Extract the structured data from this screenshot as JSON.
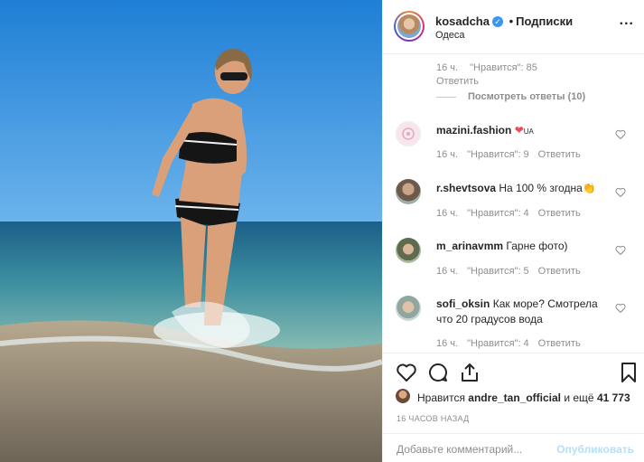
{
  "header": {
    "username": "kosadcha",
    "separator": "•",
    "follow_label": "Подписки",
    "location": "Одеса",
    "more": "..."
  },
  "thread_reply": {
    "time": "16 ч.",
    "likes": "\"Нравится\": 85",
    "reply_label": "Ответить",
    "view_replies": "Посмотреть ответы (10)"
  },
  "comments": [
    {
      "user": "mazini.fashion",
      "text": "❤",
      "suffix": "UA",
      "time": "16 ч.",
      "likes": "\"Нравится\": 9",
      "reply_label": "Ответить"
    },
    {
      "user": "r.shevtsova",
      "text": "На 100 % згодна👏",
      "time": "16 ч.",
      "likes": "\"Нравится\": 4",
      "reply_label": "Ответить"
    },
    {
      "user": "m_arinavmm",
      "text": "Гарне фото)",
      "time": "16 ч.",
      "likes": "\"Нравится\": 5",
      "reply_label": "Ответить"
    },
    {
      "user": "sofi_oksin",
      "text": "Как море? Смотрела что 20 градусов вода",
      "time": "16 ч.",
      "likes": "\"Нравится\": 4",
      "reply_label": "Ответить"
    }
  ],
  "likes_line": {
    "prefix": "Нравится",
    "user": "andre_tan_official",
    "middle": "и ещё",
    "count": "41 773"
  },
  "timestamp": "16 ЧАСОВ НАЗАД",
  "comment_box": {
    "placeholder": "Добавьте комментарий...",
    "publish_label": "Опубликовать"
  },
  "colors": {
    "accent": "#3897f0",
    "publish_disabled": "#b2dffc",
    "muted": "#8e8e8e",
    "heart_red": "#ed4956"
  }
}
